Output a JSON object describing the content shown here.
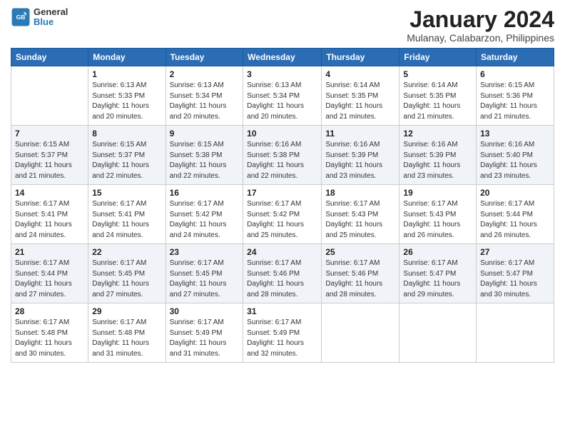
{
  "header": {
    "title": "January 2024",
    "subtitle": "Mulanay, Calabarzon, Philippines",
    "logo_line1": "General",
    "logo_line2": "Blue"
  },
  "weekdays": [
    "Sunday",
    "Monday",
    "Tuesday",
    "Wednesday",
    "Thursday",
    "Friday",
    "Saturday"
  ],
  "weeks": [
    [
      {
        "day": "",
        "sunrise": "",
        "sunset": "",
        "daylight": ""
      },
      {
        "day": "1",
        "sunrise": "Sunrise: 6:13 AM",
        "sunset": "Sunset: 5:33 PM",
        "daylight": "Daylight: 11 hours and 20 minutes."
      },
      {
        "day": "2",
        "sunrise": "Sunrise: 6:13 AM",
        "sunset": "Sunset: 5:34 PM",
        "daylight": "Daylight: 11 hours and 20 minutes."
      },
      {
        "day": "3",
        "sunrise": "Sunrise: 6:13 AM",
        "sunset": "Sunset: 5:34 PM",
        "daylight": "Daylight: 11 hours and 20 minutes."
      },
      {
        "day": "4",
        "sunrise": "Sunrise: 6:14 AM",
        "sunset": "Sunset: 5:35 PM",
        "daylight": "Daylight: 11 hours and 21 minutes."
      },
      {
        "day": "5",
        "sunrise": "Sunrise: 6:14 AM",
        "sunset": "Sunset: 5:35 PM",
        "daylight": "Daylight: 11 hours and 21 minutes."
      },
      {
        "day": "6",
        "sunrise": "Sunrise: 6:15 AM",
        "sunset": "Sunset: 5:36 PM",
        "daylight": "Daylight: 11 hours and 21 minutes."
      }
    ],
    [
      {
        "day": "7",
        "sunrise": "Sunrise: 6:15 AM",
        "sunset": "Sunset: 5:37 PM",
        "daylight": "Daylight: 11 hours and 21 minutes."
      },
      {
        "day": "8",
        "sunrise": "Sunrise: 6:15 AM",
        "sunset": "Sunset: 5:37 PM",
        "daylight": "Daylight: 11 hours and 22 minutes."
      },
      {
        "day": "9",
        "sunrise": "Sunrise: 6:15 AM",
        "sunset": "Sunset: 5:38 PM",
        "daylight": "Daylight: 11 hours and 22 minutes."
      },
      {
        "day": "10",
        "sunrise": "Sunrise: 6:16 AM",
        "sunset": "Sunset: 5:38 PM",
        "daylight": "Daylight: 11 hours and 22 minutes."
      },
      {
        "day": "11",
        "sunrise": "Sunrise: 6:16 AM",
        "sunset": "Sunset: 5:39 PM",
        "daylight": "Daylight: 11 hours and 23 minutes."
      },
      {
        "day": "12",
        "sunrise": "Sunrise: 6:16 AM",
        "sunset": "Sunset: 5:39 PM",
        "daylight": "Daylight: 11 hours and 23 minutes."
      },
      {
        "day": "13",
        "sunrise": "Sunrise: 6:16 AM",
        "sunset": "Sunset: 5:40 PM",
        "daylight": "Daylight: 11 hours and 23 minutes."
      }
    ],
    [
      {
        "day": "14",
        "sunrise": "Sunrise: 6:17 AM",
        "sunset": "Sunset: 5:41 PM",
        "daylight": "Daylight: 11 hours and 24 minutes."
      },
      {
        "day": "15",
        "sunrise": "Sunrise: 6:17 AM",
        "sunset": "Sunset: 5:41 PM",
        "daylight": "Daylight: 11 hours and 24 minutes."
      },
      {
        "day": "16",
        "sunrise": "Sunrise: 6:17 AM",
        "sunset": "Sunset: 5:42 PM",
        "daylight": "Daylight: 11 hours and 24 minutes."
      },
      {
        "day": "17",
        "sunrise": "Sunrise: 6:17 AM",
        "sunset": "Sunset: 5:42 PM",
        "daylight": "Daylight: 11 hours and 25 minutes."
      },
      {
        "day": "18",
        "sunrise": "Sunrise: 6:17 AM",
        "sunset": "Sunset: 5:43 PM",
        "daylight": "Daylight: 11 hours and 25 minutes."
      },
      {
        "day": "19",
        "sunrise": "Sunrise: 6:17 AM",
        "sunset": "Sunset: 5:43 PM",
        "daylight": "Daylight: 11 hours and 26 minutes."
      },
      {
        "day": "20",
        "sunrise": "Sunrise: 6:17 AM",
        "sunset": "Sunset: 5:44 PM",
        "daylight": "Daylight: 11 hours and 26 minutes."
      }
    ],
    [
      {
        "day": "21",
        "sunrise": "Sunrise: 6:17 AM",
        "sunset": "Sunset: 5:44 PM",
        "daylight": "Daylight: 11 hours and 27 minutes."
      },
      {
        "day": "22",
        "sunrise": "Sunrise: 6:17 AM",
        "sunset": "Sunset: 5:45 PM",
        "daylight": "Daylight: 11 hours and 27 minutes."
      },
      {
        "day": "23",
        "sunrise": "Sunrise: 6:17 AM",
        "sunset": "Sunset: 5:45 PM",
        "daylight": "Daylight: 11 hours and 27 minutes."
      },
      {
        "day": "24",
        "sunrise": "Sunrise: 6:17 AM",
        "sunset": "Sunset: 5:46 PM",
        "daylight": "Daylight: 11 hours and 28 minutes."
      },
      {
        "day": "25",
        "sunrise": "Sunrise: 6:17 AM",
        "sunset": "Sunset: 5:46 PM",
        "daylight": "Daylight: 11 hours and 28 minutes."
      },
      {
        "day": "26",
        "sunrise": "Sunrise: 6:17 AM",
        "sunset": "Sunset: 5:47 PM",
        "daylight": "Daylight: 11 hours and 29 minutes."
      },
      {
        "day": "27",
        "sunrise": "Sunrise: 6:17 AM",
        "sunset": "Sunset: 5:47 PM",
        "daylight": "Daylight: 11 hours and 30 minutes."
      }
    ],
    [
      {
        "day": "28",
        "sunrise": "Sunrise: 6:17 AM",
        "sunset": "Sunset: 5:48 PM",
        "daylight": "Daylight: 11 hours and 30 minutes."
      },
      {
        "day": "29",
        "sunrise": "Sunrise: 6:17 AM",
        "sunset": "Sunset: 5:48 PM",
        "daylight": "Daylight: 11 hours and 31 minutes."
      },
      {
        "day": "30",
        "sunrise": "Sunrise: 6:17 AM",
        "sunset": "Sunset: 5:49 PM",
        "daylight": "Daylight: 11 hours and 31 minutes."
      },
      {
        "day": "31",
        "sunrise": "Sunrise: 6:17 AM",
        "sunset": "Sunset: 5:49 PM",
        "daylight": "Daylight: 11 hours and 32 minutes."
      },
      {
        "day": "",
        "sunrise": "",
        "sunset": "",
        "daylight": ""
      },
      {
        "day": "",
        "sunrise": "",
        "sunset": "",
        "daylight": ""
      },
      {
        "day": "",
        "sunrise": "",
        "sunset": "",
        "daylight": ""
      }
    ]
  ]
}
